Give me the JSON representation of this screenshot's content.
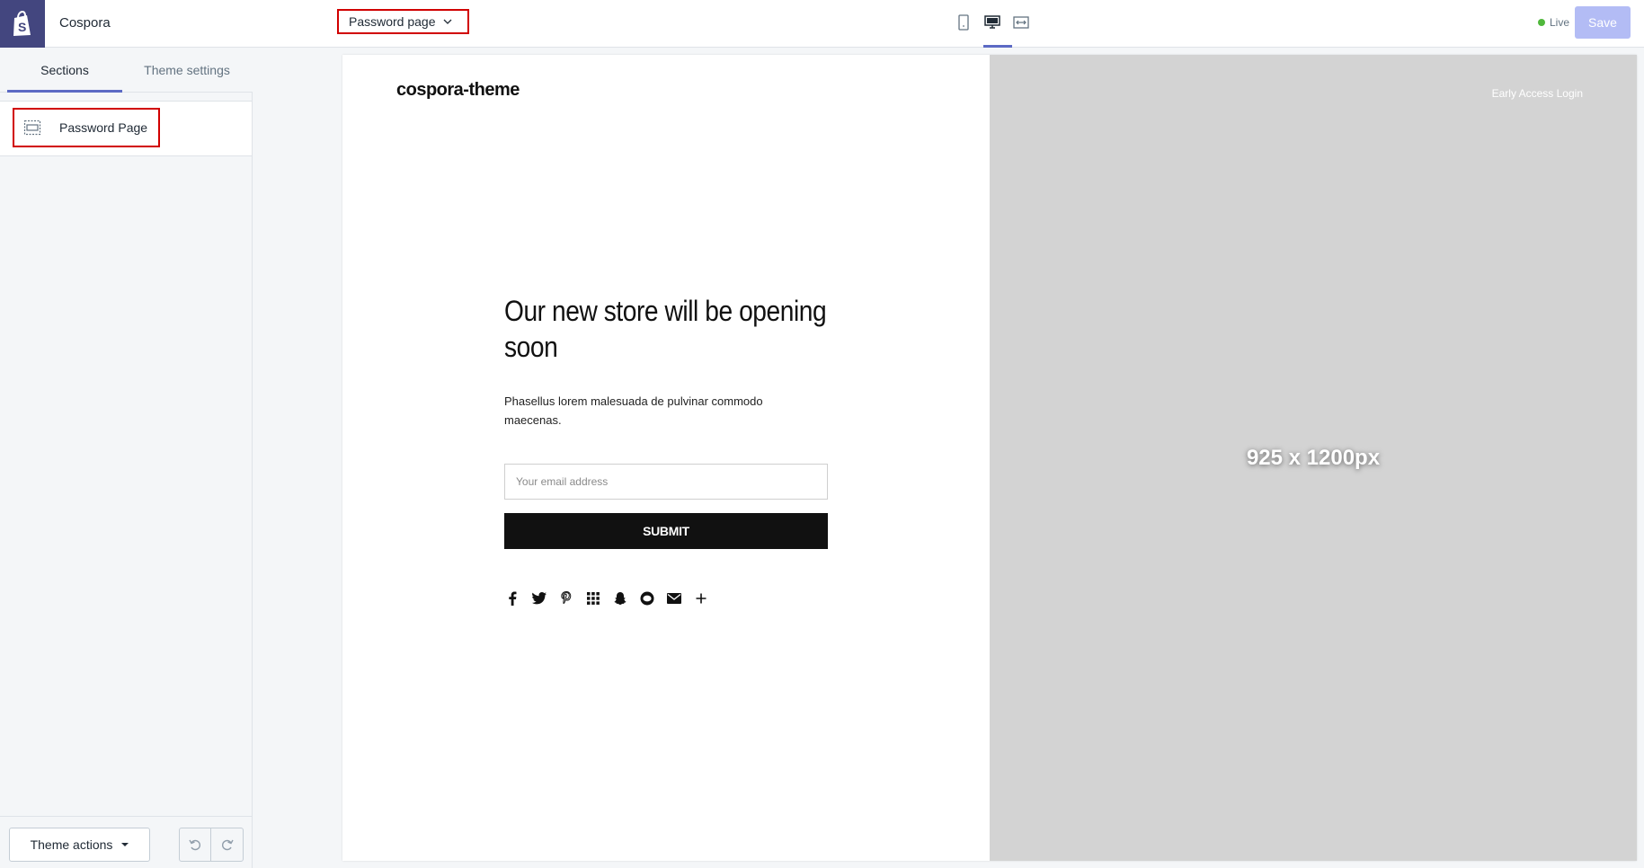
{
  "app": {
    "store_name": "Cospora"
  },
  "tabs": [
    {
      "label": "Sections"
    },
    {
      "label": "Theme settings"
    }
  ],
  "sections": [
    {
      "label": "Password Page"
    }
  ],
  "footer": {
    "theme_actions": "Theme actions"
  },
  "topbar": {
    "page_select": "Password page",
    "live_label": "Live",
    "save_label": "Save"
  },
  "preview": {
    "logo": "cospora-theme",
    "heading": "Our new store will be opening soon",
    "subtext": "Phasellus lorem malesuada de pulvinar commodo maecenas.",
    "email_placeholder": "Your email address",
    "submit_label": "SUBMIT",
    "early_access": "Early Access Login",
    "image_placeholder": "925 x 1200px",
    "social_icons": [
      "facebook-icon",
      "twitter-icon",
      "pinterest-icon",
      "apps-icon",
      "snapchat-icon",
      "line-icon",
      "email-icon",
      "more-icon"
    ]
  },
  "colors": {
    "accent": "#5c6ac4",
    "highlight": "#d10000",
    "brand_bg": "#43467f",
    "save_bg": "#b3bcf5",
    "live_dot": "#50b83c"
  }
}
